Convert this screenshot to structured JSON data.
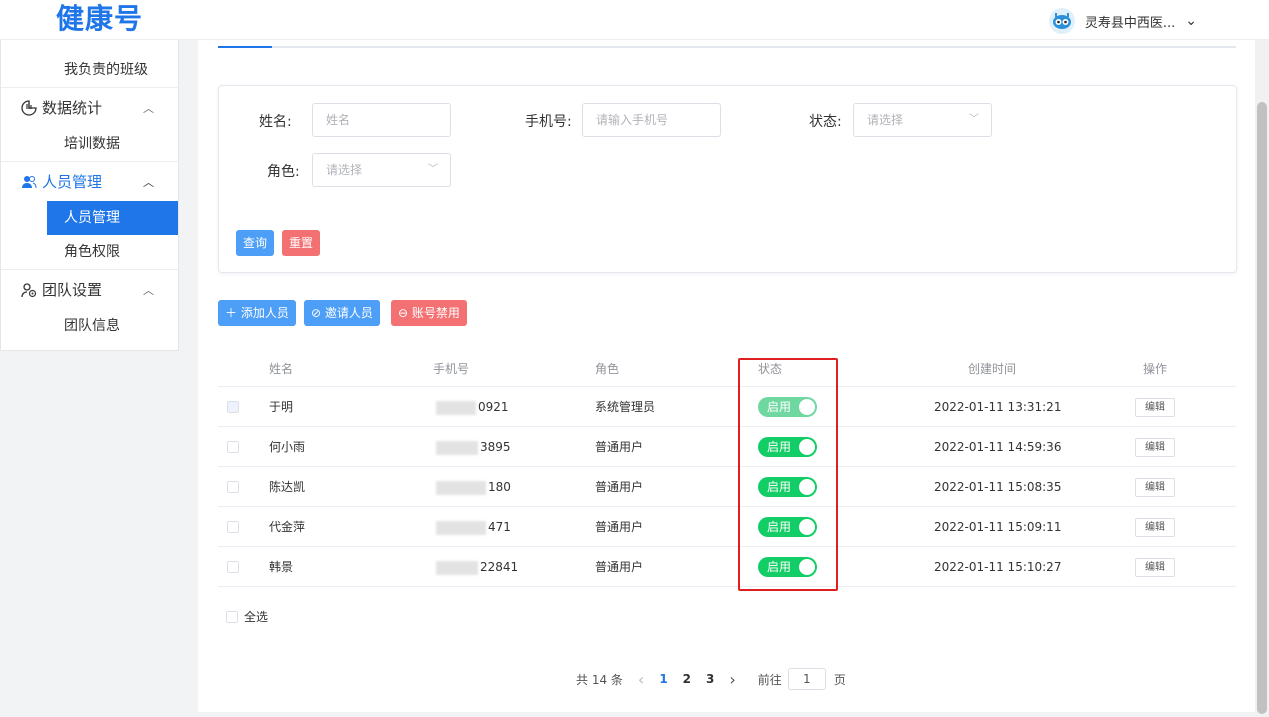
{
  "header": {
    "logo": "健康号",
    "user_name": "灵寿县中西医...",
    "user_caret": "⌄"
  },
  "sidebar": {
    "items": [
      {
        "type": "sub",
        "label": "我负责的班级"
      },
      {
        "type": "group",
        "label": "数据统计",
        "icon": "chart-icon"
      },
      {
        "type": "sub",
        "label": "培训数据"
      },
      {
        "type": "group",
        "label": "人员管理",
        "icon": "users-icon",
        "active": true
      },
      {
        "type": "sub",
        "label": "人员管理",
        "active": true
      },
      {
        "type": "sub",
        "label": "角色权限"
      },
      {
        "type": "group",
        "label": "团队设置",
        "icon": "team-icon"
      },
      {
        "type": "sub",
        "label": "团队信息"
      }
    ]
  },
  "filter": {
    "name_label": "姓名:",
    "name_placeholder": "姓名",
    "phone_label": "手机号:",
    "phone_placeholder": "请输入手机号",
    "status_label": "状态:",
    "status_placeholder": "请选择",
    "role_label": "角色:",
    "role_placeholder": "请选择",
    "query_btn": "查询",
    "reset_btn": "重置"
  },
  "actions": {
    "add": "添加人员",
    "invite": "邀请人员",
    "disable": "账号禁用"
  },
  "table": {
    "headers": {
      "name": "姓名",
      "phone": "手机号",
      "role": "角色",
      "status": "状态",
      "created": "创建时间",
      "op": "操作"
    },
    "rows": [
      {
        "name": "于明",
        "phone_tail": "0921",
        "role": "系统管理员",
        "status": "启用",
        "created": "2022-01-11 13:31:21",
        "op": "编辑"
      },
      {
        "name": "何小雨",
        "phone_tail": "3895",
        "role": "普通用户",
        "status": "启用",
        "created": "2022-01-11 14:59:36",
        "op": "编辑"
      },
      {
        "name": "陈达凯",
        "phone_tail": "180",
        "role": "普通用户",
        "status": "启用",
        "created": "2022-01-11 15:08:35",
        "op": "编辑"
      },
      {
        "name": "代金萍",
        "phone_tail": "471",
        "role": "普通用户",
        "status": "启用",
        "created": "2022-01-11 15:09:11",
        "op": "编辑"
      },
      {
        "name": "韩景",
        "phone_tail": "22841",
        "role": "普通用户",
        "status": "启用",
        "created": "2022-01-11 15:10:27",
        "op": "编辑"
      }
    ],
    "select_all": "全选"
  },
  "pagination": {
    "total": "共 14 条",
    "prev": "‹",
    "pages": [
      "1",
      "2",
      "3"
    ],
    "next": "›",
    "goto_prefix": "前往",
    "goto_value": "1",
    "goto_suffix": "页"
  },
  "colors": {
    "primary": "#1f76e8",
    "danger": "#f47173",
    "switch_on": "#13ce66",
    "highlight": "#e02020"
  }
}
